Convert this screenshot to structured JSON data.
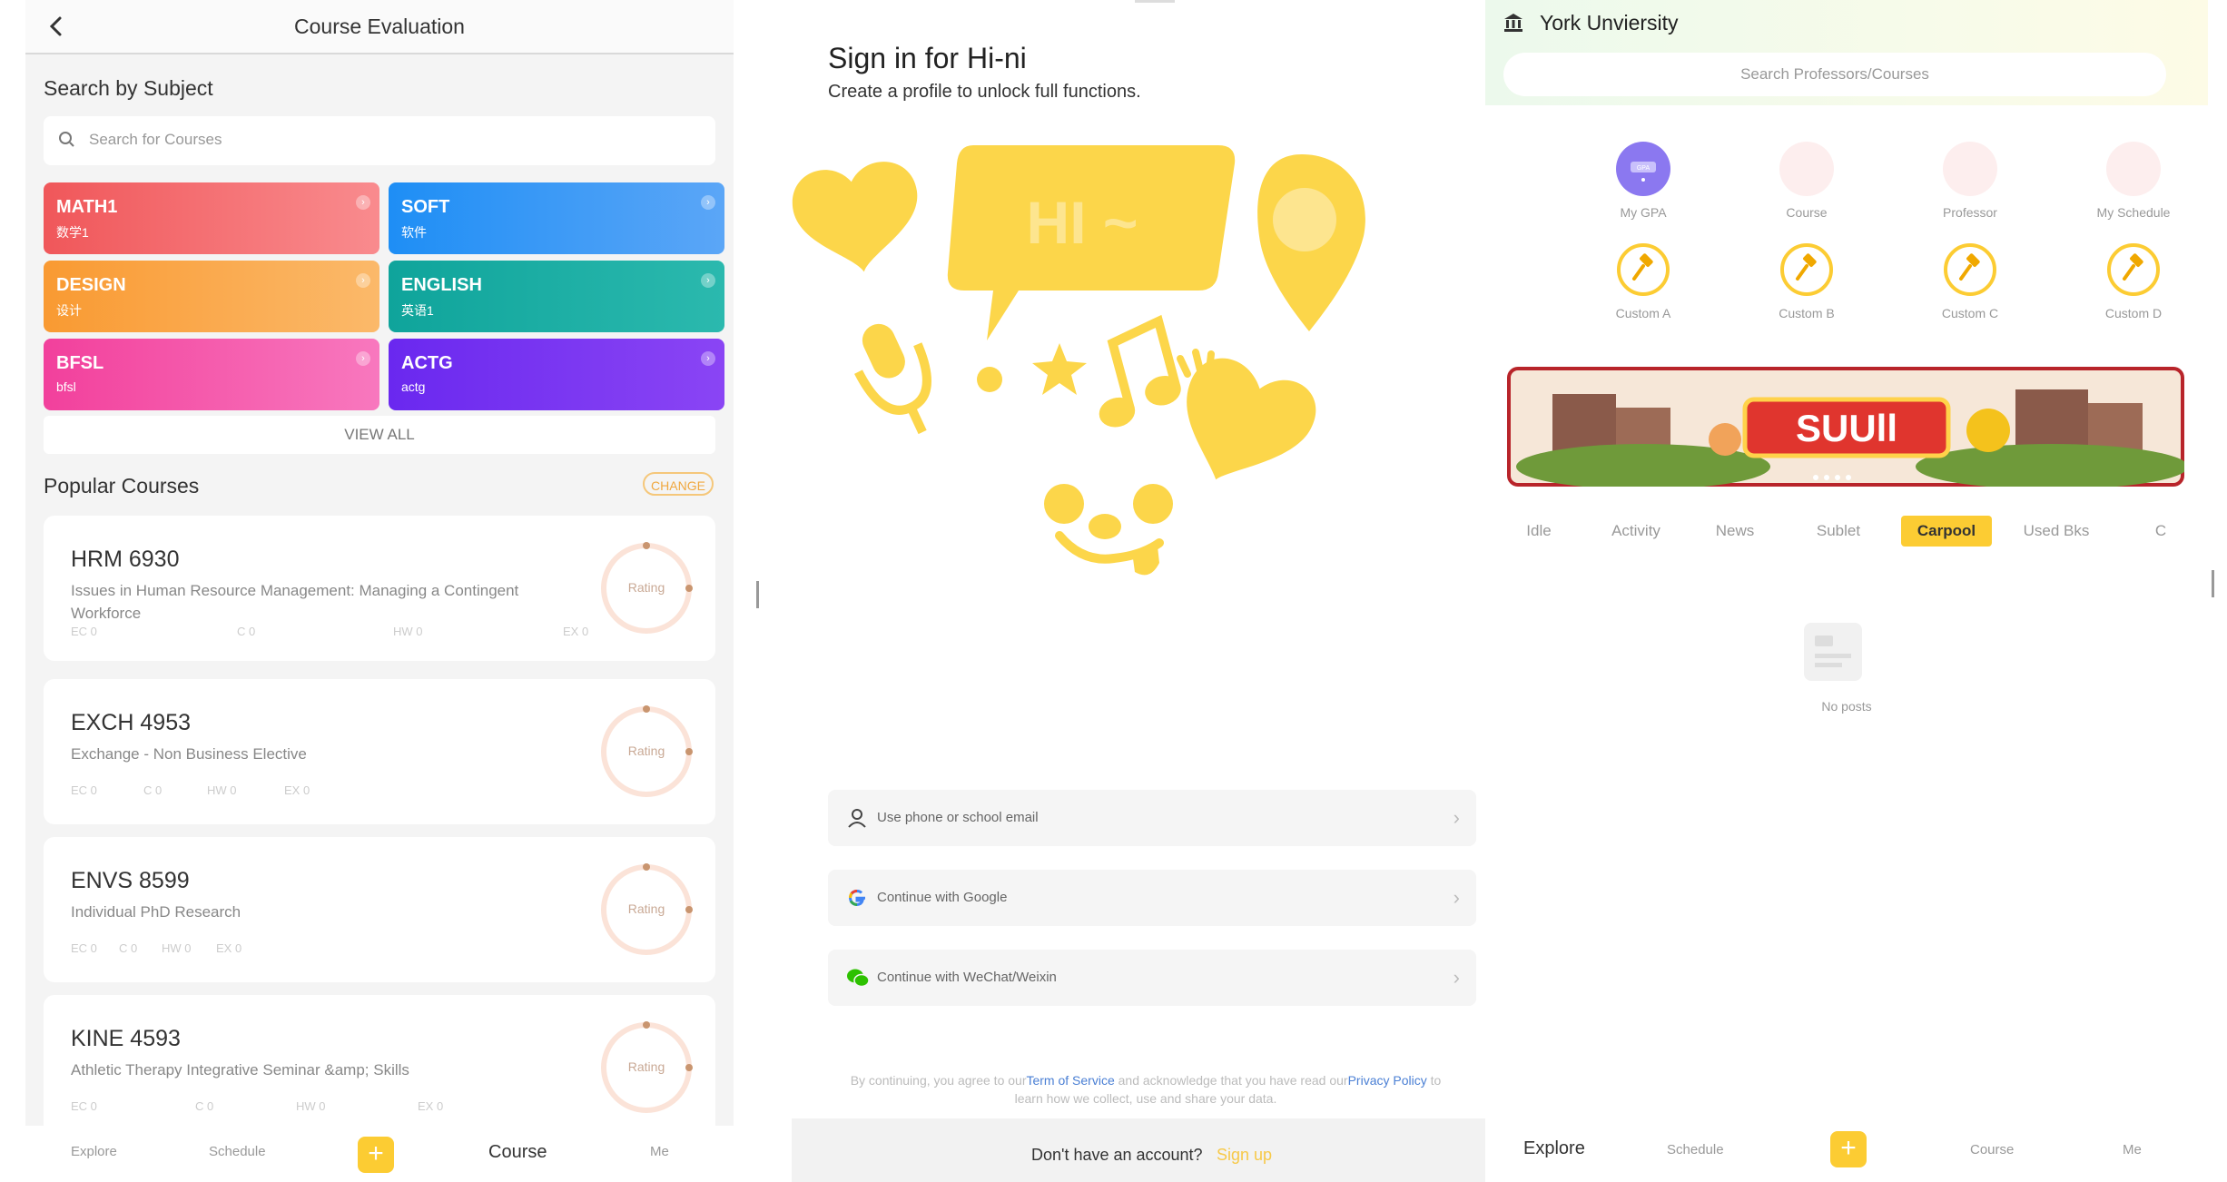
{
  "course_eval": {
    "title": "Course Evaluation",
    "search_title": "Search by Subject",
    "search_placeholder": "Search for Courses",
    "subjects": [
      {
        "code": "MATH1",
        "sub": "数学1",
        "color": "#f2605e"
      },
      {
        "code": "SOFT",
        "sub": "软件",
        "color": "#3d8ff4"
      },
      {
        "code": "DESIGN",
        "sub": "设计",
        "color": "#f6983a"
      },
      {
        "code": "ENGLISH",
        "sub": "英语1",
        "color": "#17a9a1"
      },
      {
        "code": "BFSL",
        "sub": "bfsl",
        "color": "#f2479e"
      },
      {
        "code": "ACTG",
        "sub": "actg",
        "color": "#7a32f0"
      }
    ],
    "view_all": "VIEW ALL",
    "popular_title": "Popular Courses",
    "change_label": "CHANGE",
    "courses": [
      {
        "code": "HRM 6930",
        "name": "Issues in Human Resource Management: Managing a Contingent Workforce",
        "ec": "EC 0",
        "c": "C 0",
        "hw": "HW 0",
        "ex": "EX 0",
        "rating_label": "Rating"
      },
      {
        "code": "EXCH 4953",
        "name": "Exchange - Non Business Elective",
        "ec": "EC 0",
        "c": "C 0",
        "hw": "HW 0",
        "ex": "EX 0",
        "rating_label": "Rating"
      },
      {
        "code": "ENVS 8599",
        "name": "Individual PhD Research",
        "ec": "EC 0",
        "c": "C 0",
        "hw": "HW 0",
        "ex": "EX 0",
        "rating_label": "Rating"
      },
      {
        "code": "KINE 4593",
        "name": "Athletic Therapy Integrative Seminar &amp; Skills",
        "ec": "EC 0",
        "c": "C 0",
        "hw": "HW 0",
        "ex": "EX 0",
        "rating_label": "Rating"
      }
    ],
    "tabbar": {
      "explore": "Explore",
      "schedule": "Schedule",
      "plus": "+",
      "course": "Course",
      "me": "Me"
    }
  },
  "signin": {
    "title": "Sign in for Hi-ni",
    "subtitle": "Create a profile to unlock full functions.",
    "bubble_text": "HI ~",
    "buttons": [
      {
        "label": "Use phone or school email",
        "icon": "person-icon"
      },
      {
        "label": "Continue with Google",
        "icon": "google-icon"
      },
      {
        "label": "Continue with WeChat/Weixin",
        "icon": "wechat-icon"
      }
    ],
    "terms_prefix": "By continuing, you agree to our",
    "terms_link": "Term of Service",
    "terms_mid": " and acknowledge that you have read our",
    "privacy_link": "Privacy Policy",
    "terms_suffix": " to learn how we collect, use and share your data.",
    "no_account": "Don't have an account?",
    "sign_up": "Sign up",
    "accent": "#fcd64a"
  },
  "york": {
    "university": "York Unviersity",
    "search_placeholder": "Search Professors/Courses",
    "functions": [
      "My GPA",
      "Course",
      "Professor",
      "My Schedule",
      "Custom A",
      "Custom B",
      "Custom C",
      "Custom D"
    ],
    "gpa_badge": "GPA",
    "banner_text": "SUUll",
    "categories": [
      "Idle",
      "Activity",
      "News",
      "Sublet",
      "Carpool",
      "Used Bks",
      "C"
    ],
    "active_category": "Carpool",
    "empty_text": "No posts",
    "tabbar": {
      "explore": "Explore",
      "schedule": "Schedule",
      "plus": "+",
      "course": "Course",
      "me": "Me"
    },
    "accent": "#fccc33"
  }
}
